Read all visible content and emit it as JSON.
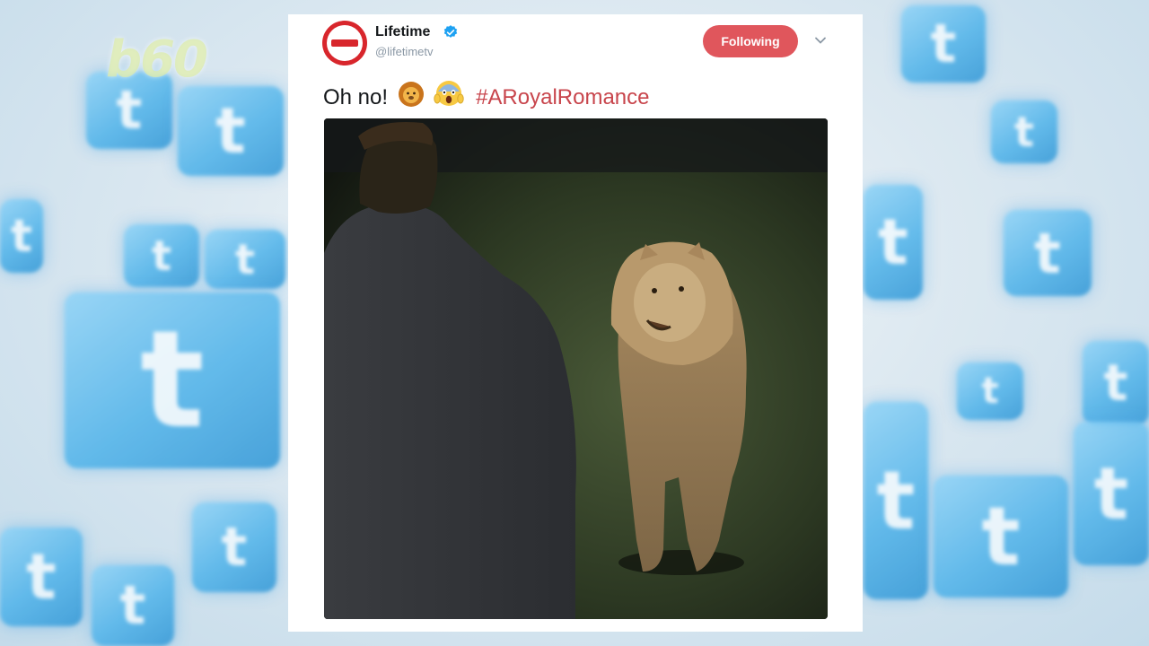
{
  "watermark": "b60",
  "tweet": {
    "author_name": "Lifetime",
    "author_handle": "@lifetimetv",
    "verified": true,
    "follow_label": "Following",
    "text_prefix": "Oh no!",
    "emojis": [
      "lion-emoji",
      "screaming-face-emoji"
    ],
    "hashtag": "#ARoyalRomance",
    "media_description": "photo"
  },
  "colors": {
    "follow_button": "#e0565c",
    "hashtag": "#c8454c",
    "avatar": "#d8262c",
    "verified_badge": "#1da1f2"
  }
}
